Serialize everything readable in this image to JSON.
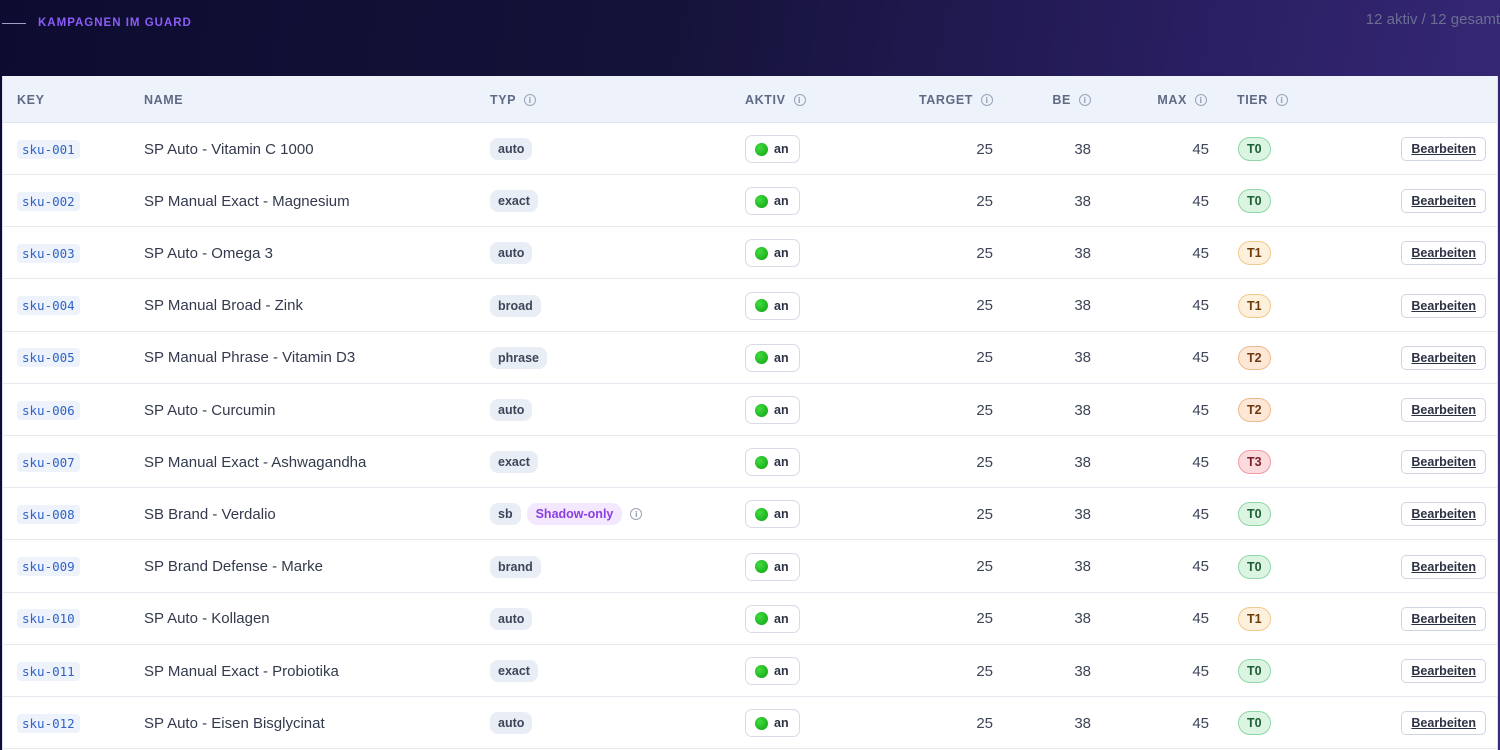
{
  "header": {
    "title": "KAMPAGNEN IM GUARD",
    "count": "12 aktiv / 12 gesamt"
  },
  "columns": {
    "key": "KEY",
    "name": "NAME",
    "typ": "TYP",
    "aktiv": "AKTIV",
    "target": "TARGET",
    "be": "BE",
    "max": "MAX",
    "tier": "TIER"
  },
  "icons": {
    "info": "info-icon",
    "status": "green-dot-icon"
  },
  "colors": {
    "accent": "#8b5cf6",
    "key_text": "#2f63c8",
    "status_on": "#16b016",
    "tier_T0": "#dcf5e3",
    "tier_T1": "#fdeed9",
    "tier_T2": "#fde5d2",
    "tier_T3": "#fbd9dc"
  },
  "rows": [
    {
      "key": "sku-001",
      "name": "SP Auto - Vitamin C 1000",
      "typ": "auto",
      "badge": "",
      "aktiv": "an",
      "target": "25",
      "be": "38",
      "max": "45",
      "tier": "T0",
      "action": "Bearbeiten"
    },
    {
      "key": "sku-002",
      "name": "SP Manual Exact - Magnesium",
      "typ": "exact",
      "badge": "",
      "aktiv": "an",
      "target": "25",
      "be": "38",
      "max": "45",
      "tier": "T0",
      "action": "Bearbeiten"
    },
    {
      "key": "sku-003",
      "name": "SP Auto - Omega 3",
      "typ": "auto",
      "badge": "",
      "aktiv": "an",
      "target": "25",
      "be": "38",
      "max": "45",
      "tier": "T1",
      "action": "Bearbeiten"
    },
    {
      "key": "sku-004",
      "name": "SP Manual Broad - Zink",
      "typ": "broad",
      "badge": "",
      "aktiv": "an",
      "target": "25",
      "be": "38",
      "max": "45",
      "tier": "T1",
      "action": "Bearbeiten"
    },
    {
      "key": "sku-005",
      "name": "SP Manual Phrase - Vitamin D3",
      "typ": "phrase",
      "badge": "",
      "aktiv": "an",
      "target": "25",
      "be": "38",
      "max": "45",
      "tier": "T2",
      "action": "Bearbeiten"
    },
    {
      "key": "sku-006",
      "name": "SP Auto - Curcumin",
      "typ": "auto",
      "badge": "",
      "aktiv": "an",
      "target": "25",
      "be": "38",
      "max": "45",
      "tier": "T2",
      "action": "Bearbeiten"
    },
    {
      "key": "sku-007",
      "name": "SP Manual Exact - Ashwagandha",
      "typ": "exact",
      "badge": "",
      "aktiv": "an",
      "target": "25",
      "be": "38",
      "max": "45",
      "tier": "T3",
      "action": "Bearbeiten"
    },
    {
      "key": "sku-008",
      "name": "SB Brand - Verdalio",
      "typ": "sb",
      "badge": "Shadow-only",
      "aktiv": "an",
      "target": "25",
      "be": "38",
      "max": "45",
      "tier": "T0",
      "action": "Bearbeiten"
    },
    {
      "key": "sku-009",
      "name": "SP Brand Defense - Marke",
      "typ": "brand",
      "badge": "",
      "aktiv": "an",
      "target": "25",
      "be": "38",
      "max": "45",
      "tier": "T0",
      "action": "Bearbeiten"
    },
    {
      "key": "sku-010",
      "name": "SP Auto - Kollagen",
      "typ": "auto",
      "badge": "",
      "aktiv": "an",
      "target": "25",
      "be": "38",
      "max": "45",
      "tier": "T1",
      "action": "Bearbeiten"
    },
    {
      "key": "sku-011",
      "name": "SP Manual Exact - Probiotika",
      "typ": "exact",
      "badge": "",
      "aktiv": "an",
      "target": "25",
      "be": "38",
      "max": "45",
      "tier": "T0",
      "action": "Bearbeiten"
    },
    {
      "key": "sku-012",
      "name": "SP Auto - Eisen Bisglycinat",
      "typ": "auto",
      "badge": "",
      "aktiv": "an",
      "target": "25",
      "be": "38",
      "max": "45",
      "tier": "T0",
      "action": "Bearbeiten"
    }
  ]
}
